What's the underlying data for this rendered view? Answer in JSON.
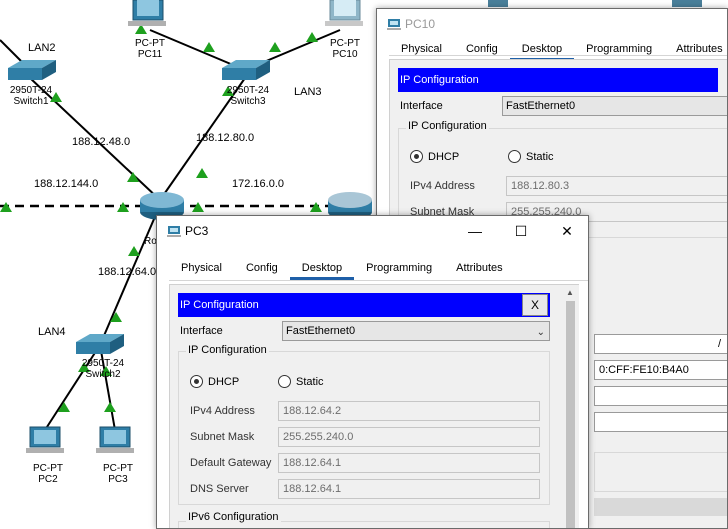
{
  "topology": {
    "lan_labels": [
      "LAN2",
      "LAN3",
      "LAN4"
    ],
    "networks": [
      "188.12.48.0",
      "188.12.80.0",
      "188.12.144.0",
      "172.16.0.0",
      "188.12.64.0"
    ],
    "switch1": {
      "model": "2950T-24",
      "name": "Switch1"
    },
    "switch3": {
      "model": "2950T-24",
      "name": "Switch3"
    },
    "switch2": {
      "model": "2950T-24",
      "name": "Switch2"
    },
    "router_name_partial": "Ro",
    "pc11": {
      "type": "PC-PT",
      "name": "PC11"
    },
    "pc10": {
      "type": "PC-PT",
      "name": "PC10"
    },
    "pc2": {
      "type": "PC-PT",
      "name": "PC2"
    },
    "pc3": {
      "type": "PC-PT",
      "name": "PC3"
    }
  },
  "pc10_window": {
    "title": "PC10",
    "tabs": [
      "Physical",
      "Config",
      "Desktop",
      "Programming",
      "Attributes"
    ],
    "active_tab": "Desktop",
    "header": "IP Configuration",
    "interface_label": "Interface",
    "interface_value": "FastEthernet0",
    "group_title": "IP Configuration",
    "dhcp_label": "DHCP",
    "static_label": "Static",
    "ipv4_label": "IPv4 Address",
    "ipv4_value": "188.12.80.3",
    "subnet_label": "Subnet Mask",
    "subnet_value": "255.255.240.0",
    "slash": "/",
    "mac_partial": "0:CFF:FE10:B4A0"
  },
  "pc3_window": {
    "title": "PC3",
    "controls": {
      "minimize": "—",
      "maximize": "☐",
      "close": "✕"
    },
    "tabs": [
      "Physical",
      "Config",
      "Desktop",
      "Programming",
      "Attributes"
    ],
    "active_tab": "Desktop",
    "header": "IP Configuration",
    "header_close": "X",
    "interface_label": "Interface",
    "interface_value": "FastEthernet0",
    "group_title": "IP Configuration",
    "dhcp_label": "DHCP",
    "static_label": "Static",
    "dhcp_selected": true,
    "ipv4_label": "IPv4 Address",
    "ipv4_value": "188.12.64.2",
    "subnet_label": "Subnet Mask",
    "subnet_value": "255.255.240.0",
    "gateway_label": "Default Gateway",
    "gateway_value": "188.12.64.1",
    "dns_label": "DNS Server",
    "dns_value": "188.12.64.1",
    "ipv6_group_title": "IPv6 Configuration"
  },
  "colors": {
    "link_up": "#1ea01e",
    "header_blue": "#0000ff",
    "tab_underline": "#1e5fa8"
  }
}
